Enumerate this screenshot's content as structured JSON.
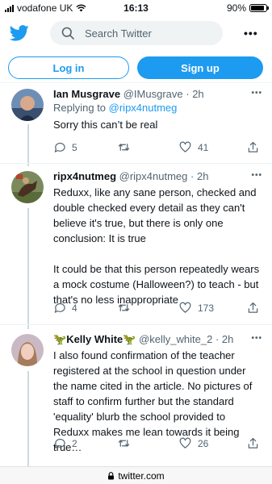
{
  "status_bar": {
    "carrier": "vodafone UK",
    "time": "16:13",
    "battery": "90%",
    "battery_level": 0.9
  },
  "header": {
    "search_placeholder": "Search Twitter",
    "more_label": "•••"
  },
  "auth": {
    "login_label": "Log in",
    "signup_label": "Sign up"
  },
  "tweets": [
    {
      "name": "Ian Musgrave",
      "emoji_prefix": "",
      "emoji_suffix": "",
      "handle": "@IMusgrave",
      "dot": "·",
      "time": "2h",
      "replying_prefix": "Replying to ",
      "replying_to": "@ripx4nutmeg",
      "text": "Sorry this can’t be real",
      "replies": "5",
      "retweets": "",
      "likes": "41"
    },
    {
      "name": "ripx4nutmeg",
      "emoji_prefix": "",
      "emoji_suffix": "",
      "handle": "@ripx4nutmeg",
      "dot": "·",
      "time": "2h",
      "text": "Reduxx, like any sane person, checked and double checked every detail as they can't believe it's true, but there is only one conclusion: It is true\n\nIt could be that this person repeatedly wears a mock costume (Halloween?) to teach - but that's no less inappropriate",
      "replies": "4",
      "retweets": "",
      "likes": "173"
    },
    {
      "name": "Kelly White",
      "emoji_prefix": "🦖",
      "emoji_suffix": "🦖",
      "handle": "@kelly_white_2",
      "dot": "·",
      "time": "2h",
      "text": "I also found confirmation of the teacher registered at the school in question under the name cited in the article. No pictures of staff to confirm further but the standard 'equality' blurb the school provided to Reduxx makes me lean towards it being true…",
      "replies": "2",
      "retweets": "",
      "likes": "26"
    }
  ],
  "url_bar": {
    "domain": "twitter.com"
  },
  "colors": {
    "accent": "#1d9bf0",
    "secondary_text": "#536471",
    "divider": "#eff3f4"
  },
  "icons": [
    "wifi-icon",
    "twitter-bird-icon",
    "search-icon",
    "reply-icon",
    "retweet-icon",
    "like-icon",
    "share-icon",
    "lock-icon"
  ]
}
